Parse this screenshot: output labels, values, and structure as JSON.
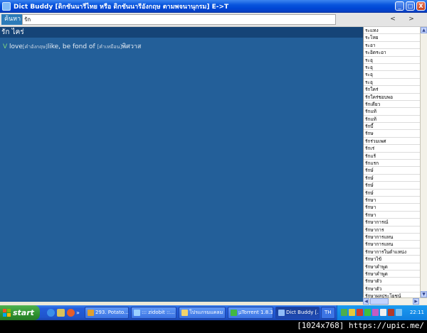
{
  "window": {
    "title": "Dict Buddy [ดิกชันนารีไทย หรือ ดิกชันนารีอังกฤษ ตามพจนานุกรม] E->T",
    "controls": {
      "minimize": "_",
      "maximize": "□",
      "close": "X"
    }
  },
  "search": {
    "label": "ค้นหา",
    "value": "รัก",
    "prev": "<",
    "next": ">"
  },
  "entry": {
    "headword": "รัก ไคร่",
    "pos": "V",
    "english_part": "love",
    "english_tag": "[คำอังกฤษ]",
    "english_rest": "like, be fond of",
    "thai_tag": "[คำเหมือน]",
    "thai_synonym": "พิศวาส"
  },
  "wordlist": [
    "ระแทง",
    "ระโหย",
    "ระอา",
    "ระอิดระอา",
    "ระอุ",
    "ระอุ",
    "ระอุ",
    "ระอุ",
    "รักใคร่",
    "รักใคร่ชอบพอ",
    "รักเดียว",
    "รักแท้",
    "รักแท้",
    "รักบี้",
    "รักษ",
    "รักร่วมเพศ",
    "รักเร่",
    "รักแร้",
    "รักแรก",
    "รักษ์",
    "รักษ์",
    "รักษ์",
    "รักษ์",
    "รักษา",
    "รักษา",
    "รักษา",
    "รักษาการณ์",
    "รักษาการ",
    "รักษาการแทน",
    "รักษาการแทน",
    "รักษาการในตำแหน่ง",
    "รักษาไข้",
    "รักษาคำพูด",
    "รักษาคำพูด",
    "รักษาตัว",
    "รักษาตัว",
    "รักษาผลประโยชน์"
  ],
  "taskbar": {
    "start": "start",
    "tasks": [
      {
        "label": "293. Potato...",
        "active": false
      },
      {
        "label": "::: zidobit ::...",
        "active": false
      },
      {
        "label": "โปรแกรมแคลม",
        "active": false
      },
      {
        "label": "µTorrent 1.8.3",
        "active": false
      },
      {
        "label": "Dict Buddy [...",
        "active": true
      }
    ],
    "lang": "TH",
    "clock": "22:11"
  },
  "watermark": "[1024x768] https://upic.me/",
  "colors": {
    "main_bg": "#235f99",
    "headword_bg": "#154477",
    "search_label_bg": "#2c7bb8",
    "pos_color": "#7fd67f"
  }
}
